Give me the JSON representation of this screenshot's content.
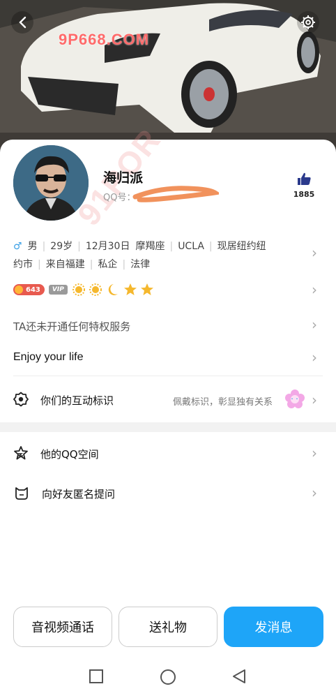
{
  "watermark": "9P668.COM",
  "watermark2": "91POR",
  "profile": {
    "name": "海归派",
    "qq_label": "QQ号：",
    "likes": "1885"
  },
  "info": {
    "sex": "♂",
    "items_line1": [
      "男",
      "29岁",
      "12月30日",
      "摩羯座",
      "UCLA",
      "现居纽约纽"
    ],
    "items_line2": [
      "约市",
      "来自福建",
      "私企",
      "法律"
    ]
  },
  "badges": {
    "coin_count": "643",
    "vip": "VIP"
  },
  "rows": {
    "privilege": "TA还未开通任何特权服务",
    "signature": "Enjoy your life",
    "interaction": "你们的互动标识",
    "interaction_hint": "佩戴标识，彰显独有关系",
    "qzone": "他的QQ空间",
    "anon_question": "向好友匿名提问"
  },
  "buttons": {
    "call": "音视频通话",
    "gift": "送礼物",
    "message": "发消息"
  },
  "colors": {
    "accent": "#1ea5f8",
    "badge_red": "#e85a4f"
  }
}
